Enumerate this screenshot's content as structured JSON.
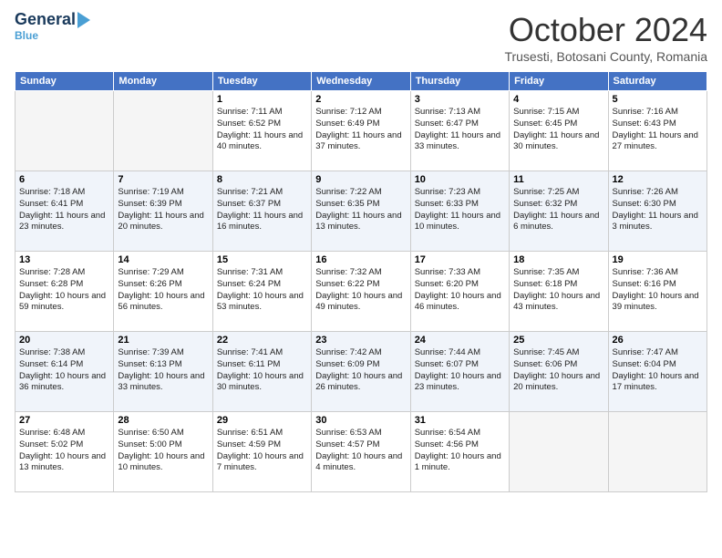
{
  "header": {
    "logo_general": "General",
    "logo_blue": "Blue",
    "month_title": "October 2024",
    "subtitle": "Trusesti, Botosani County, Romania"
  },
  "days_of_week": [
    "Sunday",
    "Monday",
    "Tuesday",
    "Wednesday",
    "Thursday",
    "Friday",
    "Saturday"
  ],
  "weeks": [
    [
      {
        "day": "",
        "empty": true
      },
      {
        "day": "",
        "empty": true
      },
      {
        "day": "1",
        "sunrise": "7:11 AM",
        "sunset": "6:52 PM",
        "daylight": "11 hours and 40 minutes."
      },
      {
        "day": "2",
        "sunrise": "7:12 AM",
        "sunset": "6:49 PM",
        "daylight": "11 hours and 37 minutes."
      },
      {
        "day": "3",
        "sunrise": "7:13 AM",
        "sunset": "6:47 PM",
        "daylight": "11 hours and 33 minutes."
      },
      {
        "day": "4",
        "sunrise": "7:15 AM",
        "sunset": "6:45 PM",
        "daylight": "11 hours and 30 minutes."
      },
      {
        "day": "5",
        "sunrise": "7:16 AM",
        "sunset": "6:43 PM",
        "daylight": "11 hours and 27 minutes."
      }
    ],
    [
      {
        "day": "6",
        "sunrise": "7:18 AM",
        "sunset": "6:41 PM",
        "daylight": "11 hours and 23 minutes."
      },
      {
        "day": "7",
        "sunrise": "7:19 AM",
        "sunset": "6:39 PM",
        "daylight": "11 hours and 20 minutes."
      },
      {
        "day": "8",
        "sunrise": "7:21 AM",
        "sunset": "6:37 PM",
        "daylight": "11 hours and 16 minutes."
      },
      {
        "day": "9",
        "sunrise": "7:22 AM",
        "sunset": "6:35 PM",
        "daylight": "11 hours and 13 minutes."
      },
      {
        "day": "10",
        "sunrise": "7:23 AM",
        "sunset": "6:33 PM",
        "daylight": "11 hours and 10 minutes."
      },
      {
        "day": "11",
        "sunrise": "7:25 AM",
        "sunset": "6:32 PM",
        "daylight": "11 hours and 6 minutes."
      },
      {
        "day": "12",
        "sunrise": "7:26 AM",
        "sunset": "6:30 PM",
        "daylight": "11 hours and 3 minutes."
      }
    ],
    [
      {
        "day": "13",
        "sunrise": "7:28 AM",
        "sunset": "6:28 PM",
        "daylight": "10 hours and 59 minutes."
      },
      {
        "day": "14",
        "sunrise": "7:29 AM",
        "sunset": "6:26 PM",
        "daylight": "10 hours and 56 minutes."
      },
      {
        "day": "15",
        "sunrise": "7:31 AM",
        "sunset": "6:24 PM",
        "daylight": "10 hours and 53 minutes."
      },
      {
        "day": "16",
        "sunrise": "7:32 AM",
        "sunset": "6:22 PM",
        "daylight": "10 hours and 49 minutes."
      },
      {
        "day": "17",
        "sunrise": "7:33 AM",
        "sunset": "6:20 PM",
        "daylight": "10 hours and 46 minutes."
      },
      {
        "day": "18",
        "sunrise": "7:35 AM",
        "sunset": "6:18 PM",
        "daylight": "10 hours and 43 minutes."
      },
      {
        "day": "19",
        "sunrise": "7:36 AM",
        "sunset": "6:16 PM",
        "daylight": "10 hours and 39 minutes."
      }
    ],
    [
      {
        "day": "20",
        "sunrise": "7:38 AM",
        "sunset": "6:14 PM",
        "daylight": "10 hours and 36 minutes."
      },
      {
        "day": "21",
        "sunrise": "7:39 AM",
        "sunset": "6:13 PM",
        "daylight": "10 hours and 33 minutes."
      },
      {
        "day": "22",
        "sunrise": "7:41 AM",
        "sunset": "6:11 PM",
        "daylight": "10 hours and 30 minutes."
      },
      {
        "day": "23",
        "sunrise": "7:42 AM",
        "sunset": "6:09 PM",
        "daylight": "10 hours and 26 minutes."
      },
      {
        "day": "24",
        "sunrise": "7:44 AM",
        "sunset": "6:07 PM",
        "daylight": "10 hours and 23 minutes."
      },
      {
        "day": "25",
        "sunrise": "7:45 AM",
        "sunset": "6:06 PM",
        "daylight": "10 hours and 20 minutes."
      },
      {
        "day": "26",
        "sunrise": "7:47 AM",
        "sunset": "6:04 PM",
        "daylight": "10 hours and 17 minutes."
      }
    ],
    [
      {
        "day": "27",
        "sunrise": "6:48 AM",
        "sunset": "5:02 PM",
        "daylight": "10 hours and 13 minutes."
      },
      {
        "day": "28",
        "sunrise": "6:50 AM",
        "sunset": "5:00 PM",
        "daylight": "10 hours and 10 minutes."
      },
      {
        "day": "29",
        "sunrise": "6:51 AM",
        "sunset": "4:59 PM",
        "daylight": "10 hours and 7 minutes."
      },
      {
        "day": "30",
        "sunrise": "6:53 AM",
        "sunset": "4:57 PM",
        "daylight": "10 hours and 4 minutes."
      },
      {
        "day": "31",
        "sunrise": "6:54 AM",
        "sunset": "4:56 PM",
        "daylight": "10 hours and 1 minute."
      },
      {
        "day": "",
        "empty": true
      },
      {
        "day": "",
        "empty": true
      }
    ]
  ]
}
